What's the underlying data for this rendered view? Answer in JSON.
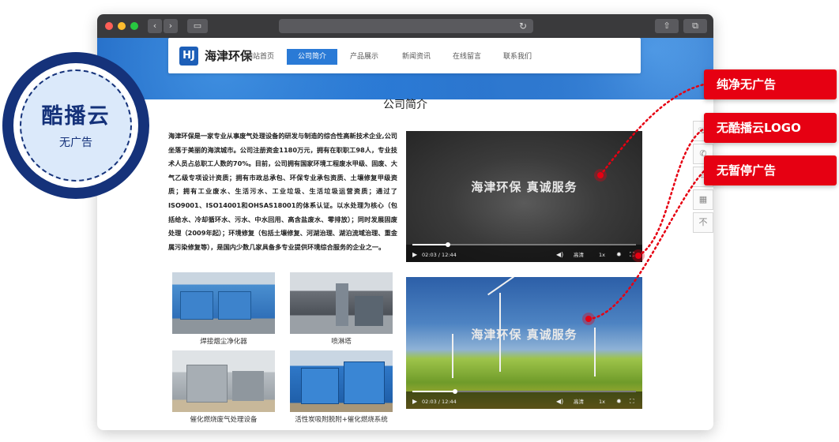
{
  "browser": {
    "nav_back": "‹",
    "nav_forward": "›",
    "reload_icon": "↻",
    "share_icon": "⇧",
    "tabs_icon": "⧉",
    "sidebar_icon": "▭"
  },
  "site": {
    "logo_mark": "HJ",
    "logo_text": "海津环保",
    "nav": [
      "网站首页",
      "公司简介",
      "产品展示",
      "新闻资讯",
      "在线留言",
      "联系我们"
    ],
    "active_nav_index": 1,
    "page_title": "公司简介",
    "intro": "海津环保是一家专业从事废气处理设备的研发与制造的综合性高新技术企业,公司坐落于美丽的海滨城市。公司注册资金1180万元，拥有在职职工98人，专业技术人员占总职工人数的70%。目前，公司拥有国家环境工程废水甲级、固废、大气乙级专项设计资质；拥有市政总承包、环保专业承包资质、土壤修复甲级资质；拥有工业废水、生活污水、工业垃圾、生活垃圾运营资质；通过了ISO9001、ISO14001和OHSAS18001的体系认证。以水处理为核心（包括给水、冷却循环水、污水、中水回用、高含盐废水、零排放）；同时发展固废处理（2009年起）；环境修复（包括土壤修复、河湖治理、湖泊流域治理、重金属污染修复等），是国内少数几家具备多专业提供环境综合服务的企业之一。",
    "products": [
      {
        "caption": "焊接烟尘净化器"
      },
      {
        "caption": "喷淋塔"
      },
      {
        "caption": "催化燃烧废气处理设备"
      },
      {
        "caption": "活性炭吸附脱附+催化燃烧系统"
      }
    ],
    "videos": [
      {
        "overlay_text": "海津环保  真诚服务",
        "time": "02:03 / 12:44",
        "quality": "高清",
        "speed": "1x",
        "progress": 0.16
      },
      {
        "overlay_text": "海津环保  真诚服务",
        "time": "02:03 / 12:44",
        "quality": "高清",
        "speed": "1x",
        "progress": 0.19
      }
    ],
    "side_tools": [
      "☏",
      "✆",
      "⌗",
      "▦",
      "不"
    ]
  },
  "badge": {
    "title": "酷播云",
    "subtitle": "无广告"
  },
  "feature_tags": [
    "纯净无广告",
    "无酷播云LOGO",
    "无暂停广告"
  ],
  "colors": {
    "accent_red": "#e60012",
    "brand_blue": "#15327a",
    "nav_blue": "#2a7ad6"
  }
}
